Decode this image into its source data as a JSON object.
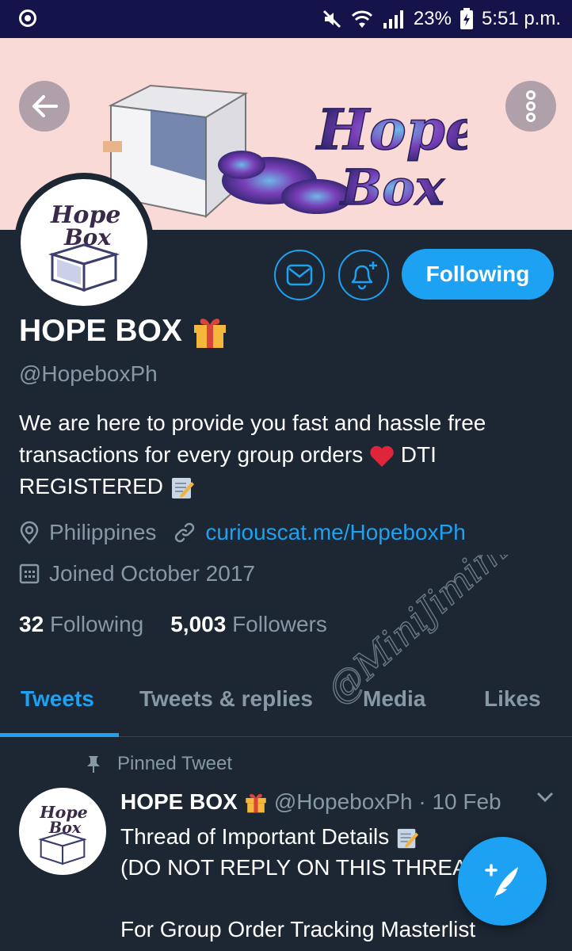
{
  "status_bar": {
    "battery": "23%",
    "time": "5:51 p.m."
  },
  "profile": {
    "name": "HOPE BOX",
    "handle": "@HopeboxPh",
    "bio_line1": "We are here to provide you fast and hassle free",
    "bio_line2": "transactions for every group orders",
    "bio_line2b": "DTI",
    "bio_line3": "REGISTERED",
    "location": "Philippines",
    "website": "curiouscat.me/HopeboxPh",
    "joined": "Joined October 2017",
    "following_count": "32",
    "following_label": "Following",
    "followers_count": "5,003",
    "followers_label": "Followers"
  },
  "actions": {
    "follow_label": "Following"
  },
  "tabs": [
    {
      "label": "Tweets"
    },
    {
      "label": "Tweets & replies"
    },
    {
      "label": "Media"
    },
    {
      "label": "Likes"
    }
  ],
  "pinned_tweet": {
    "pinned_label": "Pinned Tweet",
    "name": "HOPE BOX",
    "handle_date": "@HopeboxPh · 10 Feb",
    "line1": "Thread of Important Details",
    "line2": "(DO NOT REPLY ON THIS THREAD",
    "line4": "For Group Order Tracking Masterlist"
  },
  "watermark": "@MiniJimim",
  "colors": {
    "accent": "#1da1f2",
    "background": "#1c2733",
    "muted": "#8899a6",
    "banner": "#fadad6",
    "statusbar": "#15144a"
  }
}
